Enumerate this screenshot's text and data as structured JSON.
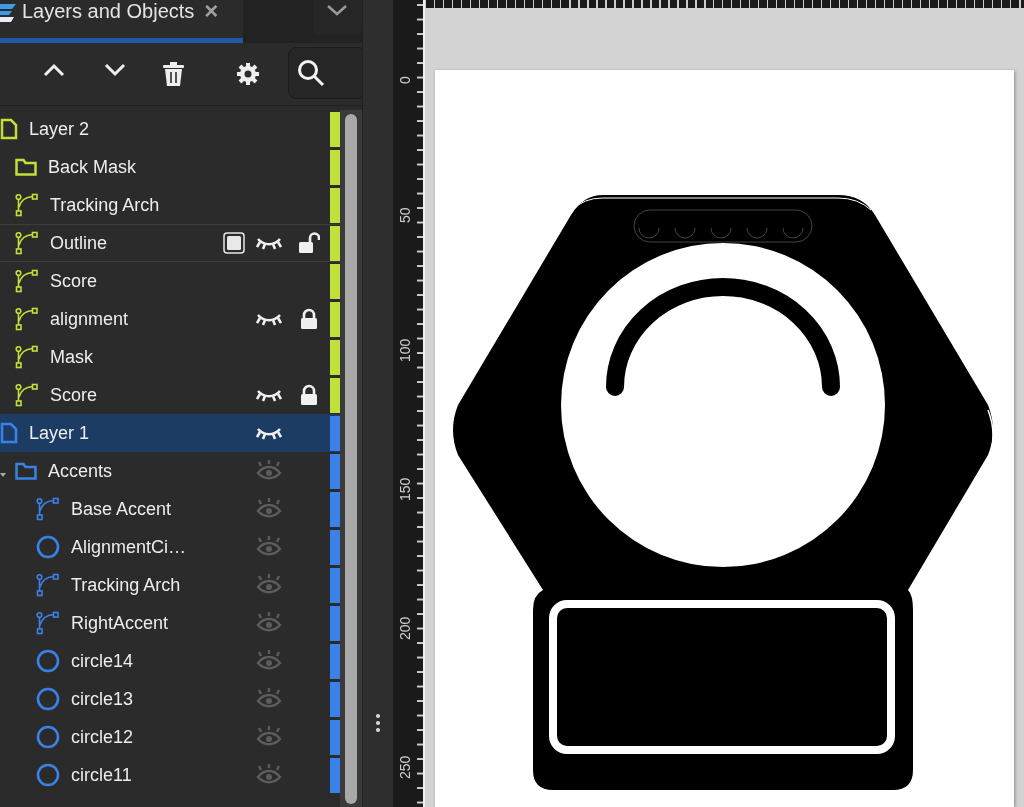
{
  "panel_tab": {
    "title": "Layers and Objects",
    "close": "×"
  },
  "layers": [
    {
      "label": "Layer 2",
      "kind": "layer",
      "color": "#c2e03a",
      "selected": false,
      "hovered": false,
      "children": [
        {
          "label": "Back Mask",
          "kind": "group",
          "selected": false,
          "hovered": false
        },
        {
          "label": "Tracking Arch",
          "kind": "path",
          "selected": false,
          "hovered": false
        },
        {
          "label": "Outline",
          "kind": "path",
          "selected": false,
          "hovered": true,
          "visible": false,
          "locked": false
        },
        {
          "label": "Score",
          "kind": "path",
          "selected": false,
          "hovered": false
        },
        {
          "label": "alignment",
          "kind": "path",
          "selected": false,
          "hovered": false,
          "visible": false,
          "locked": true
        },
        {
          "label": "Mask",
          "kind": "path",
          "selected": false,
          "hovered": false
        },
        {
          "label": "Score",
          "kind": "path",
          "selected": false,
          "hovered": false,
          "visible": false,
          "locked": true
        }
      ]
    },
    {
      "label": "Layer 1",
      "kind": "layer",
      "color": "#3b82e8",
      "selected": true,
      "hovered": false,
      "visible": false,
      "children": [
        {
          "label": "Accents",
          "kind": "group",
          "selected": false,
          "hovered": false,
          "expanded": true,
          "visible": true,
          "children": [
            {
              "label": "Base Accent",
              "kind": "path",
              "selected": false,
              "hovered": false,
              "visible": true
            },
            {
              "label": "AlignmentCi…",
              "kind": "circle",
              "selected": false,
              "hovered": false,
              "visible": true
            },
            {
              "label": "Tracking Arch",
              "kind": "path",
              "selected": false,
              "hovered": false,
              "visible": true
            },
            {
              "label": "RightAccent",
              "kind": "path",
              "selected": false,
              "hovered": false,
              "visible": true
            },
            {
              "label": "circle14",
              "kind": "circle",
              "selected": false,
              "hovered": false,
              "visible": true
            },
            {
              "label": "circle13",
              "kind": "circle",
              "selected": false,
              "hovered": false,
              "visible": true
            },
            {
              "label": "circle12",
              "kind": "circle",
              "selected": false,
              "hovered": false,
              "visible": true
            },
            {
              "label": "circle11",
              "kind": "circle",
              "selected": false,
              "hovered": false,
              "visible": true
            }
          ]
        }
      ]
    }
  ],
  "ruler": {
    "vertical_labels": [
      "0",
      "50",
      "100",
      "150",
      "200",
      "250"
    ]
  }
}
